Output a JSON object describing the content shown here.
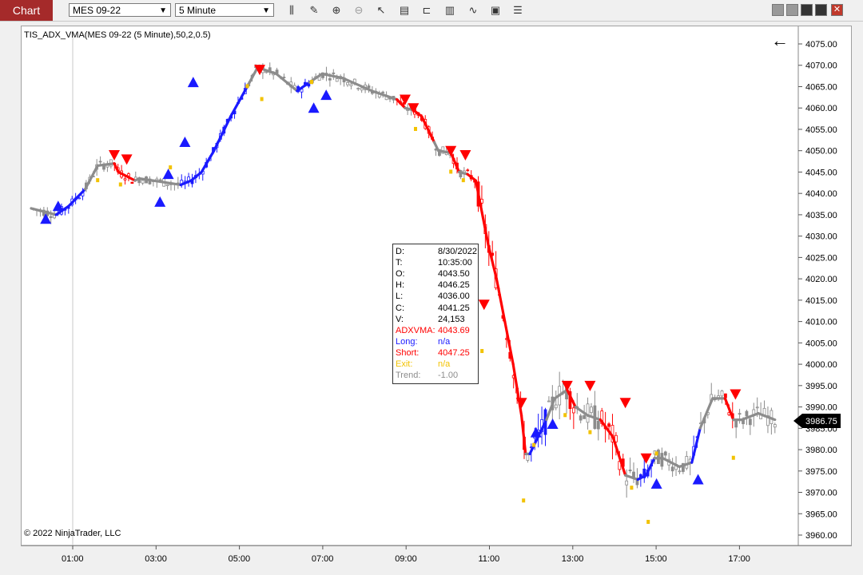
{
  "toolbar": {
    "chart_label": "Chart",
    "instrument": "MES 09-22",
    "interval": "5 Minute",
    "tool_icons": [
      "bars-icon",
      "pencil-icon",
      "zoom-in-icon",
      "zoom-out-icon",
      "pointer-icon",
      "data-box-icon",
      "range-icon",
      "chart-style-icon",
      "indicator-icon",
      "properties-icon",
      "list-icon"
    ]
  },
  "chart": {
    "indicator_label": "TIS_ADX_VMA(MES 09-22 (5 Minute),50,2,0.5)",
    "copyright": "© 2022 NinjaTrader, LLC",
    "back_arrow": "←",
    "last_price": "3986.75",
    "colors": {
      "long": "#1a1aff",
      "short": "#ff0000",
      "neutral": "#8c8c8c",
      "exit": "#f2c200",
      "price_box": "#000000"
    }
  },
  "chart_data": {
    "type": "candlestick",
    "y_ticks": [
      "4075.00",
      "4070.00",
      "4065.00",
      "4060.00",
      "4055.00",
      "4050.00",
      "4045.00",
      "4040.00",
      "4035.00",
      "4030.00",
      "4025.00",
      "4020.00",
      "4015.00",
      "4010.00",
      "4005.00",
      "4000.00",
      "3995.00",
      "3990.00",
      "3985.00",
      "3980.00",
      "3975.00",
      "3970.00",
      "3965.00",
      "3960.00"
    ],
    "x_ticks": [
      "01:00",
      "03:00",
      "05:00",
      "07:00",
      "09:00",
      "11:00",
      "13:00",
      "15:00",
      "17:00"
    ],
    "ylim": [
      3958,
      4079
    ],
    "vma_line": [
      {
        "t": 0.0,
        "v": 4036.5,
        "s": 0
      },
      {
        "t": 0.6,
        "v": 4035,
        "s": 0
      },
      {
        "t": 0.9,
        "v": 4037,
        "s": 1
      },
      {
        "t": 1.3,
        "v": 4041,
        "s": 1
      },
      {
        "t": 1.6,
        "v": 4046.5,
        "s": 0
      },
      {
        "t": 2.0,
        "v": 4047,
        "s": 0
      },
      {
        "t": 2.1,
        "v": 4045,
        "s": -1
      },
      {
        "t": 2.5,
        "v": 4043,
        "s": -1
      },
      {
        "t": 2.6,
        "v": 4043.5,
        "s": 0
      },
      {
        "t": 3.6,
        "v": 4042,
        "s": 0
      },
      {
        "t": 3.85,
        "v": 4043,
        "s": 1
      },
      {
        "t": 4.1,
        "v": 4045,
        "s": 1
      },
      {
        "t": 4.4,
        "v": 4050,
        "s": 1
      },
      {
        "t": 4.8,
        "v": 4058,
        "s": 1
      },
      {
        "t": 5.2,
        "v": 4065,
        "s": 1
      },
      {
        "t": 5.45,
        "v": 4069.5,
        "s": 0
      },
      {
        "t": 5.9,
        "v": 4068,
        "s": 0
      },
      {
        "t": 6.4,
        "v": 4064,
        "s": 0
      },
      {
        "t": 6.7,
        "v": 4066,
        "s": 1
      },
      {
        "t": 7.0,
        "v": 4068,
        "s": 0
      },
      {
        "t": 7.5,
        "v": 4067,
        "s": 0
      },
      {
        "t": 8.2,
        "v": 4064,
        "s": 0
      },
      {
        "t": 8.8,
        "v": 4062,
        "s": 0
      },
      {
        "t": 9.0,
        "v": 4060,
        "s": -1
      },
      {
        "t": 9.2,
        "v": 4059.5,
        "s": 0
      },
      {
        "t": 9.4,
        "v": 4058,
        "s": -1
      },
      {
        "t": 9.7,
        "v": 4052,
        "s": -1
      },
      {
        "t": 9.8,
        "v": 4050,
        "s": 0
      },
      {
        "t": 10.1,
        "v": 4049.5,
        "s": 0
      },
      {
        "t": 10.3,
        "v": 4045,
        "s": -1
      },
      {
        "t": 10.5,
        "v": 4044.5,
        "s": 0
      },
      {
        "t": 10.7,
        "v": 4043,
        "s": -1
      },
      {
        "t": 11.0,
        "v": 4028,
        "s": -1
      },
      {
        "t": 11.2,
        "v": 4020,
        "s": -1
      },
      {
        "t": 11.4,
        "v": 4010,
        "s": -1
      },
      {
        "t": 11.6,
        "v": 4000,
        "s": -1
      },
      {
        "t": 11.8,
        "v": 3988,
        "s": -1
      },
      {
        "t": 11.9,
        "v": 3979,
        "s": -1
      },
      {
        "t": 12.0,
        "v": 3979,
        "s": 0
      },
      {
        "t": 12.2,
        "v": 3983,
        "s": 1
      },
      {
        "t": 12.4,
        "v": 3987,
        "s": 1
      },
      {
        "t": 12.6,
        "v": 3992,
        "s": 0
      },
      {
        "t": 12.9,
        "v": 3994,
        "s": 0
      },
      {
        "t": 13.1,
        "v": 3990,
        "s": -1
      },
      {
        "t": 13.4,
        "v": 3988,
        "s": 0
      },
      {
        "t": 13.7,
        "v": 3987,
        "s": 0
      },
      {
        "t": 14.0,
        "v": 3983,
        "s": -1
      },
      {
        "t": 14.3,
        "v": 3974,
        "s": -1
      },
      {
        "t": 14.6,
        "v": 3973,
        "s": 0
      },
      {
        "t": 14.8,
        "v": 3974,
        "s": 1
      },
      {
        "t": 15.0,
        "v": 3978,
        "s": 1
      },
      {
        "t": 15.2,
        "v": 3978,
        "s": 0
      },
      {
        "t": 15.6,
        "v": 3976,
        "s": 0
      },
      {
        "t": 15.9,
        "v": 3977,
        "s": 0
      },
      {
        "t": 16.1,
        "v": 3985,
        "s": 1
      },
      {
        "t": 16.4,
        "v": 3992,
        "s": 0
      },
      {
        "t": 16.7,
        "v": 3992,
        "s": 0
      },
      {
        "t": 16.9,
        "v": 3987,
        "s": -1
      },
      {
        "t": 17.1,
        "v": 3987,
        "s": 0
      },
      {
        "t": 17.5,
        "v": 3988.5,
        "s": 0
      },
      {
        "t": 17.9,
        "v": 3987,
        "s": 0
      }
    ],
    "long_signals": [
      {
        "t": 0.35,
        "v": 4034
      },
      {
        "t": 0.65,
        "v": 4037
      },
      {
        "t": 3.1,
        "v": 4038
      },
      {
        "t": 3.3,
        "v": 4044.5
      },
      {
        "t": 3.7,
        "v": 4052
      },
      {
        "t": 3.9,
        "v": 4066
      },
      {
        "t": 6.8,
        "v": 4060
      },
      {
        "t": 7.1,
        "v": 4063
      },
      {
        "t": 12.15,
        "v": 3984
      },
      {
        "t": 12.55,
        "v": 3986
      },
      {
        "t": 15.05,
        "v": 3972
      },
      {
        "t": 16.05,
        "v": 3973
      }
    ],
    "short_signals": [
      {
        "t": 2.0,
        "v": 4049
      },
      {
        "t": 2.3,
        "v": 4048
      },
      {
        "t": 5.5,
        "v": 4069
      },
      {
        "t": 9.0,
        "v": 4062
      },
      {
        "t": 9.2,
        "v": 4060
      },
      {
        "t": 10.1,
        "v": 4050
      },
      {
        "t": 10.45,
        "v": 4049
      },
      {
        "t": 10.9,
        "v": 4014
      },
      {
        "t": 11.8,
        "v": 3991
      },
      {
        "t": 12.9,
        "v": 3995
      },
      {
        "t": 13.45,
        "v": 3995
      },
      {
        "t": 14.3,
        "v": 3991
      },
      {
        "t": 14.8,
        "v": 3978
      },
      {
        "t": 16.95,
        "v": 3993
      }
    ],
    "exit_marks": [
      {
        "t": 1.6,
        "v": 4043
      },
      {
        "t": 2.15,
        "v": 4042
      },
      {
        "t": 3.35,
        "v": 4046
      },
      {
        "t": 5.2,
        "v": 4065
      },
      {
        "t": 5.55,
        "v": 4062
      },
      {
        "t": 6.75,
        "v": 4066
      },
      {
        "t": 9.25,
        "v": 4055
      },
      {
        "t": 10.1,
        "v": 4045
      },
      {
        "t": 10.4,
        "v": 4043
      },
      {
        "t": 10.85,
        "v": 4003
      },
      {
        "t": 11.85,
        "v": 3968
      },
      {
        "t": 12.1,
        "v": 3981
      },
      {
        "t": 12.85,
        "v": 3988
      },
      {
        "t": 13.45,
        "v": 3984
      },
      {
        "t": 14.45,
        "v": 3971
      },
      {
        "t": 14.85,
        "v": 3963
      },
      {
        "t": 15.05,
        "v": 3979
      },
      {
        "t": 16.9,
        "v": 3978
      }
    ]
  },
  "data_window": {
    "rows": [
      {
        "label": "D:",
        "value": "8/30/2022",
        "color": "#000000"
      },
      {
        "label": "T:",
        "value": "10:35:00",
        "color": "#000000"
      },
      {
        "label": "O:",
        "value": "4043.50",
        "color": "#000000"
      },
      {
        "label": "H:",
        "value": "4046.25",
        "color": "#000000"
      },
      {
        "label": "L:",
        "value": "4036.00",
        "color": "#000000"
      },
      {
        "label": "C:",
        "value": "4041.25",
        "color": "#000000"
      },
      {
        "label": "V:",
        "value": "24,153",
        "color": "#000000"
      },
      {
        "label": "ADXVMA:",
        "value": "4043.69",
        "color": "#ff0000"
      },
      {
        "label": "Long:",
        "value": "n/a",
        "color": "#1a1aff"
      },
      {
        "label": "Short:",
        "value": "4047.25",
        "color": "#ff0000"
      },
      {
        "label": "Exit:",
        "value": "n/a",
        "color": "#f2c200"
      },
      {
        "label": "Trend:",
        "value": "-1.00",
        "color": "#8c8c8c"
      }
    ]
  }
}
